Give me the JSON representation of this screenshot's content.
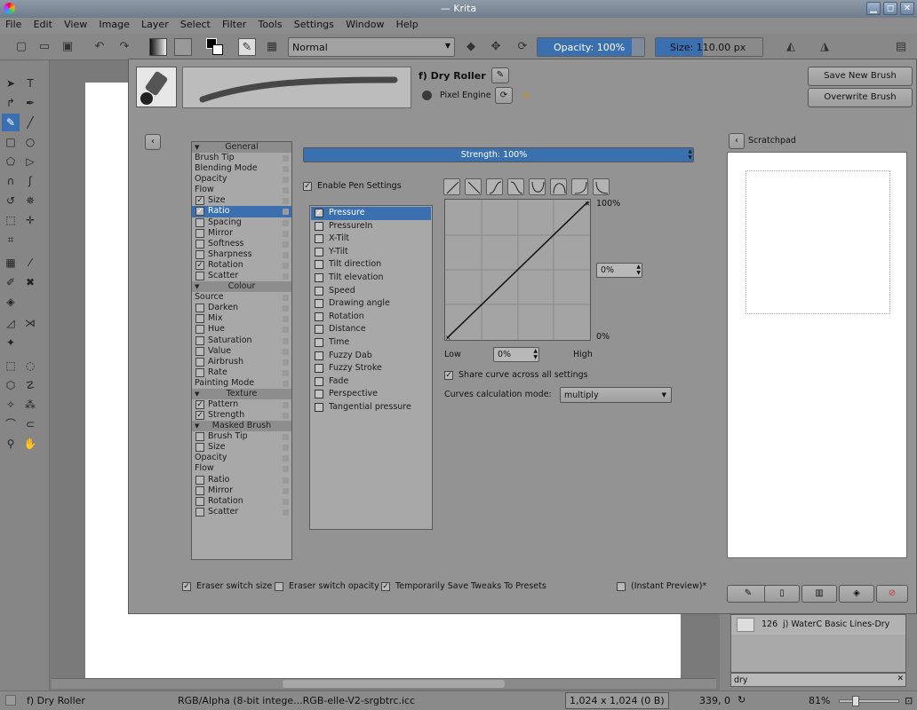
{
  "window": {
    "title": "— Krita"
  },
  "menu": [
    "File",
    "Edit",
    "View",
    "Image",
    "Layer",
    "Select",
    "Filter",
    "Tools",
    "Settings",
    "Window",
    "Help"
  ],
  "toolbar": {
    "blend_mode": "Normal",
    "opacity": "Opacity: 100%",
    "size": "Size: 110.00 px"
  },
  "dialog": {
    "preset_name": "f) Dry Roller",
    "engine": "Pixel Engine",
    "save_new": "Save New Brush Preset...",
    "overwrite": "Overwrite Brush",
    "strength_label": "Strength: 100%",
    "strength_value": 1.0,
    "enable_pen": "Enable Pen Settings",
    "curve_labels": {
      "top": "100%",
      "bottom": "0%",
      "low": "Low",
      "high": "High"
    },
    "curve_spin_right": "0%",
    "curve_spin_bottom": "0%",
    "share_curve": "Share curve across all settings",
    "calc_mode_label": "Curves calculation mode:",
    "calc_mode": "multiply",
    "eraser_size": "Eraser switch size",
    "eraser_opacity": "Eraser switch opacity",
    "temp_save": "Temporarily Save Tweaks To Presets",
    "instant_preview": "(Instant Preview)*",
    "options": [
      {
        "type": "header",
        "label": "General"
      },
      {
        "type": "plain",
        "label": "Brush Tip"
      },
      {
        "type": "plain",
        "label": "Blending Mode"
      },
      {
        "type": "plain",
        "label": "Opacity"
      },
      {
        "type": "plain",
        "label": "Flow"
      },
      {
        "type": "cb",
        "label": "Size",
        "checked": true
      },
      {
        "type": "cb",
        "label": "Ratio",
        "checked": true,
        "selected": true
      },
      {
        "type": "cb",
        "label": "Spacing",
        "checked": false
      },
      {
        "type": "cb",
        "label": "Mirror",
        "checked": false
      },
      {
        "type": "cb",
        "label": "Softness",
        "checked": false
      },
      {
        "type": "cb",
        "label": "Sharpness",
        "checked": false
      },
      {
        "type": "cb",
        "label": "Rotation",
        "checked": true
      },
      {
        "type": "cb",
        "label": "Scatter",
        "checked": false
      },
      {
        "type": "header",
        "label": "Colour"
      },
      {
        "type": "plain",
        "label": "Source"
      },
      {
        "type": "cb",
        "label": "Darken",
        "checked": false
      },
      {
        "type": "cb",
        "label": "Mix",
        "checked": false
      },
      {
        "type": "cb",
        "label": "Hue",
        "checked": false
      },
      {
        "type": "cb",
        "label": "Saturation",
        "checked": false
      },
      {
        "type": "cb",
        "label": "Value",
        "checked": false
      },
      {
        "type": "cb",
        "label": "Airbrush",
        "checked": false
      },
      {
        "type": "cb",
        "label": "Rate",
        "checked": false
      },
      {
        "type": "plain",
        "label": "Painting Mode"
      },
      {
        "type": "header",
        "label": "Texture"
      },
      {
        "type": "cb",
        "label": "Pattern",
        "checked": true
      },
      {
        "type": "cb",
        "label": "Strength",
        "checked": true
      },
      {
        "type": "header",
        "label": "Masked Brush"
      },
      {
        "type": "cb",
        "label": "Brush Tip",
        "checked": false
      },
      {
        "type": "cb",
        "label": "Size",
        "checked": false
      },
      {
        "type": "plain",
        "label": "Opacity"
      },
      {
        "type": "plain",
        "label": "Flow"
      },
      {
        "type": "cb",
        "label": "Ratio",
        "checked": false
      },
      {
        "type": "cb",
        "label": "Mirror",
        "checked": false
      },
      {
        "type": "cb",
        "label": "Rotation",
        "checked": false
      },
      {
        "type": "cb",
        "label": "Scatter",
        "checked": false
      }
    ],
    "sensors": [
      {
        "label": "Pressure",
        "checked": true,
        "selected": true
      },
      {
        "label": "PressureIn",
        "checked": false
      },
      {
        "label": "X-Tilt",
        "checked": false
      },
      {
        "label": "Y-Tilt",
        "checked": false
      },
      {
        "label": "Tilt direction",
        "checked": false
      },
      {
        "label": "Tilt elevation",
        "checked": false
      },
      {
        "label": "Speed",
        "checked": false
      },
      {
        "label": "Drawing angle",
        "checked": false
      },
      {
        "label": "Rotation",
        "checked": false
      },
      {
        "label": "Distance",
        "checked": false
      },
      {
        "label": "Time",
        "checked": false
      },
      {
        "label": "Fuzzy Dab",
        "checked": false
      },
      {
        "label": "Fuzzy Stroke",
        "checked": false
      },
      {
        "label": "Fade",
        "checked": false
      },
      {
        "label": "Perspective",
        "checked": false
      },
      {
        "label": "Tangential pressure",
        "checked": false
      }
    ]
  },
  "scratchpad": {
    "title": "Scratchpad"
  },
  "presets": {
    "count": "126",
    "item": "j) WaterC Basic Lines-Dry",
    "filter": "dry"
  },
  "status": {
    "preset": "f) Dry Roller",
    "colorspace": "RGB/Alpha (8-bit intege...RGB-elle-V2-srgbtrc.icc",
    "dimensions": "1,024 x 1,024 (0 B)",
    "coords": "339, 0",
    "zoom": "81%"
  },
  "checks": {
    "enable_pen": true,
    "share_curve": true,
    "eraser_size": true,
    "eraser_opacity": false,
    "temp_save": true,
    "instant_preview": false
  }
}
